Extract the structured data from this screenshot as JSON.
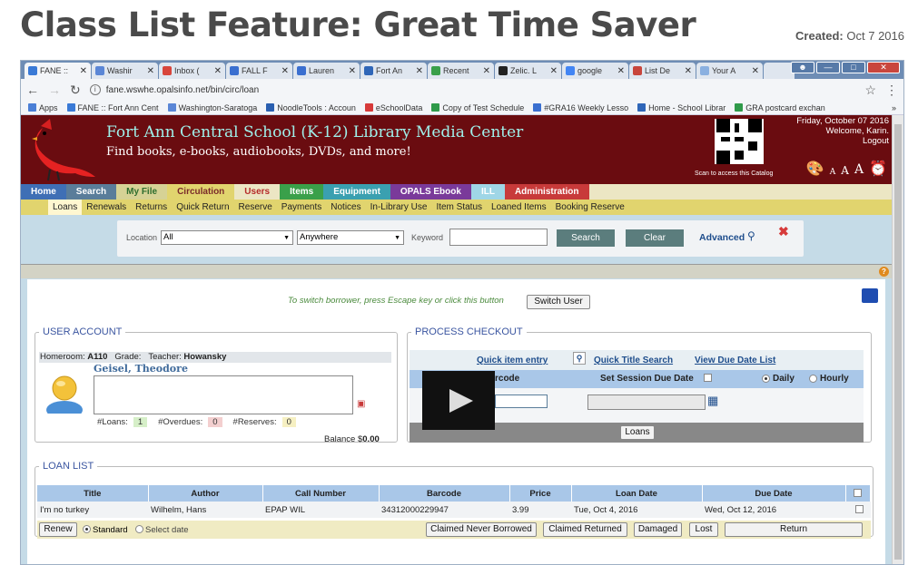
{
  "blog": {
    "title": "Class List Feature: Great Time Saver",
    "created_label": "Created:",
    "created_date": "Oct 7 2016"
  },
  "browser": {
    "tabs": [
      {
        "label": "FANE ::",
        "color": "#3a7ad6"
      },
      {
        "label": "Washir",
        "color": "#5a86d6"
      },
      {
        "label": "Inbox (",
        "color": "#d8453b"
      },
      {
        "label": "FALL F",
        "color": "#3a6fd0"
      },
      {
        "label": "Lauren",
        "color": "#3a6fd0"
      },
      {
        "label": "Fort An",
        "color": "#2f66b8"
      },
      {
        "label": "Recent",
        "color": "#3aa04a"
      },
      {
        "label": "Zelic. L",
        "color": "#222222"
      },
      {
        "label": "google",
        "color": "#4285f4"
      },
      {
        "label": "List De",
        "color": "#c8453b"
      },
      {
        "label": "Your A",
        "color": "#8ab0e0"
      }
    ],
    "url": "fane.wswhe.opalsinfo.net/bin/circ/loan",
    "bookmarks": [
      {
        "label": "Apps",
        "color": "#4a7fd6"
      },
      {
        "label": "FANE :: Fort Ann Cent",
        "color": "#3a7ad6"
      },
      {
        "label": "Washington-Saratoga",
        "color": "#5a86d6"
      },
      {
        "label": "NoodleTools : Accoun",
        "color": "#2a5fb0"
      },
      {
        "label": "eSchoolData",
        "color": "#d63a3a"
      },
      {
        "label": "Copy of Test Schedule",
        "color": "#2f9a4a"
      },
      {
        "label": "#GRA16 Weekly Lesso",
        "color": "#3a6fd0"
      },
      {
        "label": "Home - School Librar",
        "color": "#2f66b8"
      },
      {
        "label": "GRA postcard exchan",
        "color": "#2f9a4a"
      }
    ],
    "more": "»"
  },
  "banner": {
    "library_name": "Fort Ann Central School (K-12) Library Media Center",
    "tagline": "Find books, e-books, audiobooks, DVDs, and more!",
    "qr_caption": "Scan to access this Catalog",
    "date": "Friday, October 07 2016",
    "welcome": "Welcome, Karin.",
    "logout": "Logout",
    "text_sizes": [
      "A",
      "A",
      "A"
    ]
  },
  "main_nav": [
    {
      "label": "Home",
      "bg": "#3f6fb5",
      "fg": "#ffffff"
    },
    {
      "label": "Search",
      "bg": "#5a7d9a",
      "fg": "#ffffff"
    },
    {
      "label": "My File",
      "bg": "#d6d295",
      "fg": "#2f6e2f"
    },
    {
      "label": "Circulation",
      "bg": "#e1d46e",
      "fg": "#7a2a2a"
    },
    {
      "label": "Users",
      "bg": "#ece6c4",
      "fg": "#b52a2a"
    },
    {
      "label": "Items",
      "bg": "#3aa04a",
      "fg": "#ffffff"
    },
    {
      "label": "Equipment",
      "bg": "#3aa0b0",
      "fg": "#ffffff"
    },
    {
      "label": "OPALS Ebook",
      "bg": "#7a3a9a",
      "fg": "#ffffff"
    },
    {
      "label": "ILL",
      "bg": "#9fd6e6",
      "fg": "#ffffff"
    },
    {
      "label": "Administration",
      "bg": "#c83a3a",
      "fg": "#ffffff"
    }
  ],
  "sub_nav": [
    "Loans",
    "Renewals",
    "Returns",
    "Quick Return",
    "Reserve",
    "Payments",
    "Notices",
    "In-Library Use",
    "Item Status",
    "Loaned Items",
    "Booking Reserve"
  ],
  "search": {
    "location_label": "Location",
    "location_value": "All",
    "scope_value": "Anywhere",
    "keyword_label": "Keyword",
    "keyword_value": "",
    "search_btn": "Search",
    "clear_btn": "Clear",
    "advanced": "Advanced"
  },
  "switch": {
    "hint": "To switch borrower, press Escape key or click this button",
    "button": "Switch User"
  },
  "user_account": {
    "legend": "USER ACCOUNT",
    "homeroom_label": "Homeroom:",
    "homeroom": "A110",
    "grade_label": "Grade:",
    "grade": "",
    "teacher_label": "Teacher:",
    "teacher": "Howansky",
    "name": "Geisel, Theodore",
    "loans_label": "#Loans:",
    "loans": "1",
    "overdues_label": "#Overdues:",
    "overdues": "0",
    "reserves_label": "#Reserves:",
    "reserves": "0",
    "balance_label": "Balance $",
    "balance": "0.00"
  },
  "checkout": {
    "legend": "PROCESS CHECKOUT",
    "quick_item": "Quick item entry",
    "quick_title": "Quick Title Search",
    "view_due": "View Due Date List",
    "barcode_head": "rcode",
    "session_due": "Set Session Due Date",
    "daily": "Daily",
    "hourly": "Hourly",
    "loans_btn": "Loans"
  },
  "loan_list": {
    "legend": "LOAN LIST",
    "columns": [
      "Title",
      "Author",
      "Call Number",
      "Barcode",
      "Price",
      "Loan Date",
      "Due Date"
    ],
    "rows": [
      {
        "title": "I'm no turkey",
        "author": "Wilhelm, Hans",
        "call": "EPAP WIL",
        "barcode": "34312000229947",
        "price": "3.99",
        "loan": "Tue, Oct 4, 2016",
        "due": "Wed, Oct 12, 2016"
      }
    ],
    "renew_btn": "Renew",
    "standard": "Standard",
    "select_date": "Select date",
    "claimed_never": "Claimed Never Borrowed",
    "claimed_returned": "Claimed Returned",
    "damaged": "Damaged",
    "lost": "Lost",
    "return": "Return"
  }
}
